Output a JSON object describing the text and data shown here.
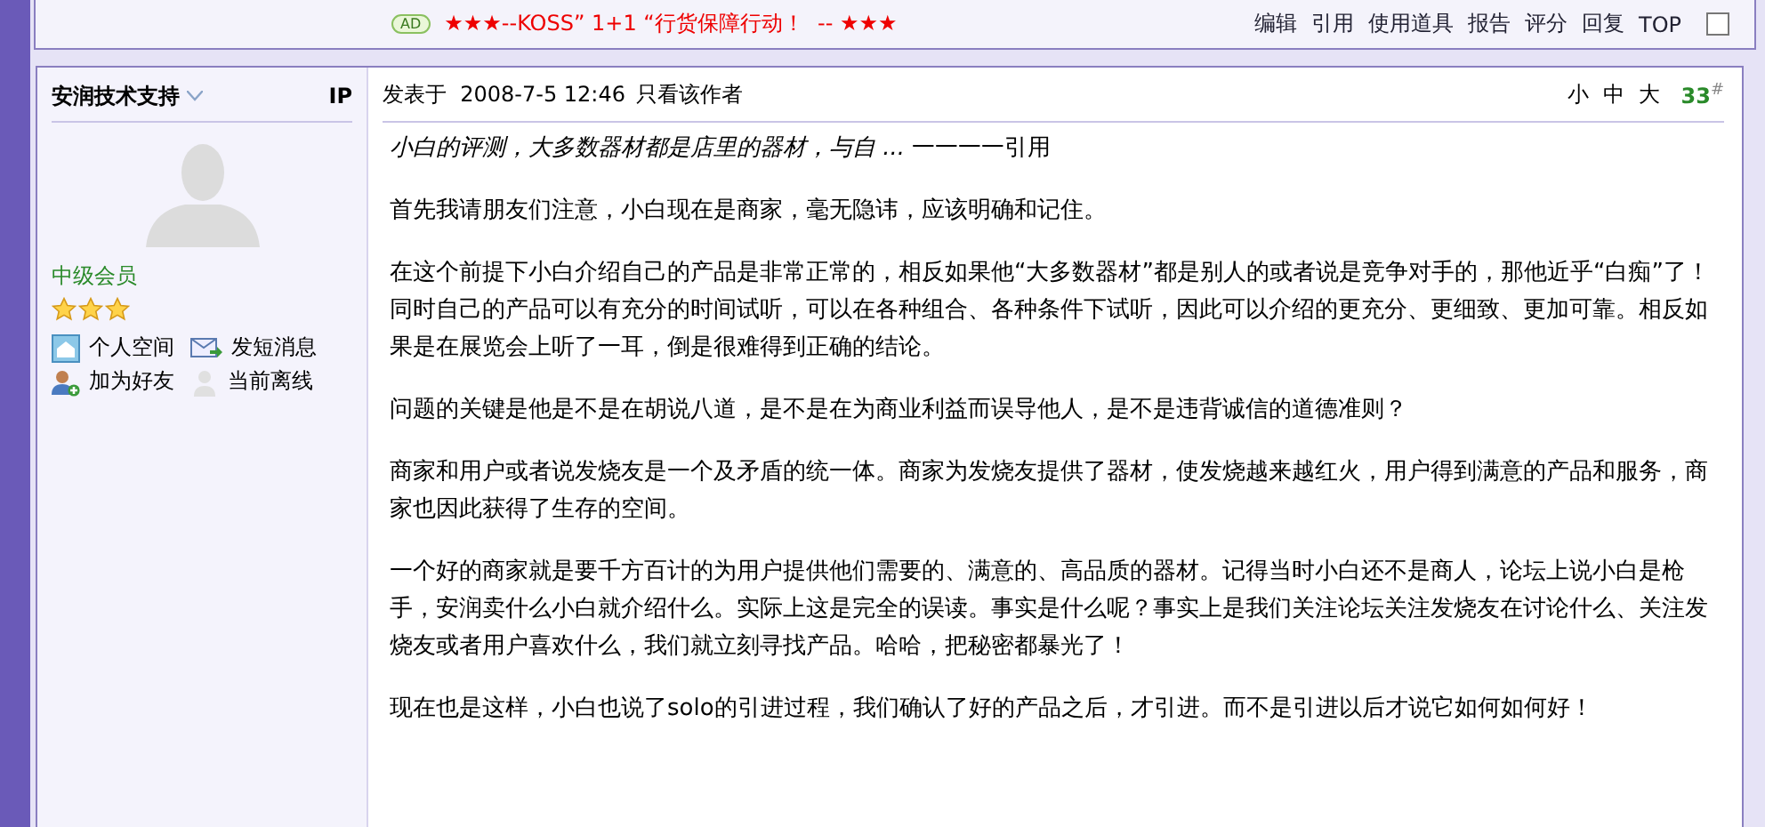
{
  "prev_post": {
    "ad_badge": "AD",
    "ad_text": "★★★--KOSS” 1+1 “行货保障行动！  -- ★★★",
    "actions": [
      "编辑",
      "引用",
      "使用道具",
      "报告",
      "评分",
      "回复",
      "TOP"
    ],
    "select_checked": false
  },
  "author": {
    "name": "安润技术支持",
    "ip": "IP",
    "rank": "中级会员",
    "stars": 3,
    "links": [
      {
        "kind": "home",
        "label": "个人空间"
      },
      {
        "kind": "message",
        "label": "发短消息"
      },
      {
        "kind": "friend",
        "label": "加为好友"
      },
      {
        "kind": "offline",
        "label": "当前离线"
      }
    ]
  },
  "post": {
    "posted_label": "发表于",
    "time": "2008-7-5 12:46",
    "author_only": "只看该作者",
    "font_sizes": [
      "小",
      "中",
      "大"
    ],
    "floor": "33",
    "floor_mark": "#",
    "quote": "小白的评测，大多数器材都是店里的器材，与自 ...",
    "quote_link": "一一一一引用",
    "paragraphs": [
      [
        "首先我请朋友们注意，小白现在是商家，毫无隐讳，应该明确和记住。"
      ],
      [
        "在这个前提下小白介绍自己的产品是非常正常的，相反如果他“大多数器材”都是别人的或者说是竞争对手的，那他近乎“白痴”了！",
        "同时自己的产品可以有充分的时间试听，可以在各种组合、各种条件下试听，因此可以介绍的更充分、更细致、更加可靠。相反如果是在展览会上听了一耳，倒是很难得到正确的结论。"
      ],
      [
        "问题的关键是他是不是在胡说八道，是不是在为商业利益而误导他人，是不是违背诚信的道德准则？"
      ],
      [
        "商家和用户或者说发烧友是一个及矛盾的统一体。商家为发烧友提供了器材，使发烧越来越红火，用户得到满意的产品和服务，商家也因此获得了生存的空间。"
      ],
      [
        "一个好的商家就是要千方百计的为用户提供他们需要的、满意的、高品质的器材。记得当时小白还不是商人，论坛上说小白是枪手，安润卖什么小白就介绍什么。实际上这是完全的误读。事实是什么呢？事实上是我们关注论坛关注发烧友在讨论什么、关注发烧友或者用户喜欢什么，我们就立刻寻找产品。哈哈，把秘密都暴光了！"
      ],
      [
        "现在也是这样，小白也说了solo的引进过程，我们确认了好的产品之后，才引进。而不是引进以后才说它如何如何好！"
      ]
    ]
  }
}
